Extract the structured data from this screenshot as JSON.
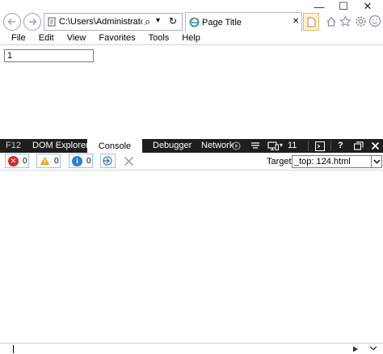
{
  "window": {
    "minimize_glyph": "—",
    "maximize_glyph": "☐",
    "close_glyph": "✕"
  },
  "address": {
    "url": "C:\\Users\\Administrator\\Desl",
    "search_glyph": "⌕",
    "dropdown_glyph": "▾",
    "refresh_glyph": "↻"
  },
  "tab": {
    "title": "Page Title",
    "close_glyph": "✕"
  },
  "menu": {
    "items": [
      "File",
      "Edit",
      "View",
      "Favorites",
      "Tools",
      "Help"
    ]
  },
  "page": {
    "input_value": "1"
  },
  "devtools": {
    "tabs": {
      "f12": "F12",
      "dom": "DOM Explorer",
      "console": "Console",
      "debugger": "Debugger",
      "network": "Network"
    },
    "emulation_count": "11",
    "help_glyph": "?",
    "counts": {
      "errors": "0",
      "warnings": "0",
      "info": "0"
    },
    "target_label": "Target",
    "target_value": "_top: 124.html",
    "colors": {
      "error": "#d42b2b",
      "warning": "#e8a11a",
      "info": "#2a7fd4",
      "bar": "#1e1e1e"
    }
  }
}
